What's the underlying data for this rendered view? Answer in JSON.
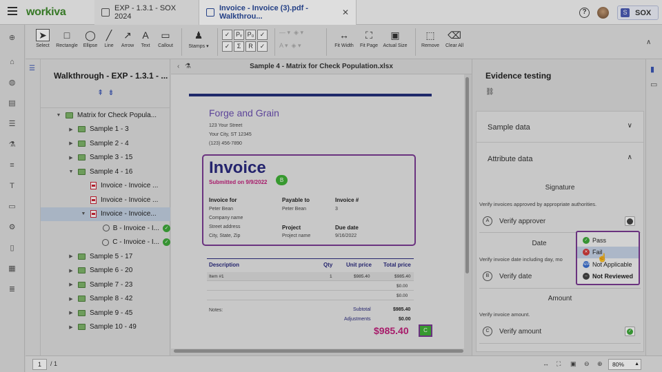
{
  "app": {
    "logo": "workiva"
  },
  "tabs": [
    {
      "label": "EXP - 1.3.1 - SOX 2024"
    },
    {
      "label": "Invoice - Invoice (3).pdf - Walkthrou..."
    }
  ],
  "user": {
    "initial": "S",
    "name": "SOX"
  },
  "toolbar": {
    "tools": [
      "Select",
      "Rectangle",
      "Ellipse",
      "Line",
      "Arrow",
      "Text",
      "Callout",
      "Stamps",
      "Fit Width",
      "Fit Page",
      "Actual Size",
      "Remove",
      "Clear All"
    ],
    "stamp_glyphs": [
      "✓",
      "Pᵥ",
      "P₀",
      "✓",
      "✓",
      "Σ",
      "R",
      "✓"
    ]
  },
  "left_panel": {
    "title": "Walkthrough - EXP - 1.3.1 - ...",
    "tree": [
      {
        "label": "Matrix for Check Popula...",
        "kind": "folder",
        "indent": 0,
        "caret": "▼"
      },
      {
        "label": "Sample 1 - 3",
        "kind": "folder",
        "indent": 1,
        "caret": "▶"
      },
      {
        "label": "Sample 2 - 4",
        "kind": "folder",
        "indent": 1,
        "caret": "▶"
      },
      {
        "label": "Sample 3 - 15",
        "kind": "folder",
        "indent": 1,
        "caret": "▶"
      },
      {
        "label": "Sample 4 - 16",
        "kind": "folder",
        "indent": 1,
        "caret": "▼"
      },
      {
        "label": "Invoice - Invoice ...",
        "kind": "pdf",
        "indent": 2,
        "caret": ""
      },
      {
        "label": "Invoice - Invoice ...",
        "kind": "pdf",
        "indent": 2,
        "caret": ""
      },
      {
        "label": "Invoice - Invoice...",
        "kind": "pdf",
        "indent": 2,
        "caret": "▼",
        "selected": true
      },
      {
        "label": "B - Invoice - I...",
        "kind": "evidence",
        "indent": 3,
        "caret": "",
        "check": true
      },
      {
        "label": "C - Invoice - I...",
        "kind": "evidence",
        "indent": 3,
        "caret": "",
        "check": true
      },
      {
        "label": "Sample 5 - 17",
        "kind": "folder",
        "indent": 1,
        "caret": "▶"
      },
      {
        "label": "Sample 6 - 20",
        "kind": "folder",
        "indent": 1,
        "caret": "▶"
      },
      {
        "label": "Sample 7 - 23",
        "kind": "folder",
        "indent": 1,
        "caret": "▶"
      },
      {
        "label": "Sample 8 - 42",
        "kind": "folder",
        "indent": 1,
        "caret": "▶"
      },
      {
        "label": "Sample 9 - 45",
        "kind": "folder",
        "indent": 1,
        "caret": "▶"
      },
      {
        "label": "Sample 10 - 49",
        "kind": "folder",
        "indent": 1,
        "caret": "▶"
      }
    ]
  },
  "center": {
    "file_name": "Sample 4 - Matrix for Check Population.xlsx",
    "invoice": {
      "company": "Forge and Grain",
      "address": [
        "123 Your Street",
        "Your City, ST 12345",
        "(123) 456-7890"
      ],
      "title": "Invoice",
      "submitted": "Submitted on 9/9/2022",
      "badge_b": "B",
      "invoice_for_label": "Invoice for",
      "invoice_for": [
        "Peter Bean",
        "Company name",
        "Street address",
        "City, State, Zip"
      ],
      "payable_label": "Payable to",
      "payable": "Peter Bean",
      "project_label": "Project",
      "project": "Project name",
      "invoice_no_label": "Invoice #",
      "invoice_no": "3",
      "due_label": "Due date",
      "due": "9/16/2022",
      "table_headers": [
        "Description",
        "Qty",
        "Unit price",
        "Total price"
      ],
      "rows": [
        {
          "desc": "Item #1",
          "qty": "1",
          "unit": "$985.40",
          "total": "$985.40"
        },
        {
          "desc": "",
          "qty": "",
          "unit": "",
          "total": "$0.00"
        },
        {
          "desc": "",
          "qty": "",
          "unit": "",
          "total": "$0.00"
        }
      ],
      "notes_label": "Notes:",
      "subtotal_label": "Subtotal",
      "subtotal": "$985.40",
      "adjustments_label": "Adjustments",
      "adjustments": "$0.00",
      "total": "$985.40",
      "badge_c": "C"
    }
  },
  "right_panel": {
    "title": "Evidence testing",
    "sections": [
      {
        "label": "Sample data",
        "chevron": "∨"
      },
      {
        "label": "Attribute data",
        "chevron": "∧"
      }
    ],
    "attributes": [
      {
        "heading": "Signature",
        "desc": "Verify invoices approved by appropriate authorities.",
        "letter": "A",
        "name": "Verify approver",
        "status": "not-reviewed"
      },
      {
        "heading": "Date",
        "desc": "Verify invoice date including day, mo",
        "letter": "B",
        "name": "Verify date",
        "status": "none"
      },
      {
        "heading": "Amount",
        "desc": "Verify invoice amount.",
        "letter": "C",
        "name": "Verify amount",
        "status": "pass"
      }
    ],
    "status_menu": [
      {
        "label": "Pass",
        "color": "#3fa93a",
        "glyph": "✓"
      },
      {
        "label": "Fail",
        "color": "#d33a3a",
        "glyph": "✕",
        "highlighted": true
      },
      {
        "label": "Not Applicable",
        "color": "#3a6fd0",
        "glyph": "N/A"
      },
      {
        "label": "Not Reviewed",
        "color": "#444444",
        "glyph": "–",
        "bold": true
      }
    ]
  },
  "bottom": {
    "page": "1",
    "of": "/ 1",
    "zoom": "80%"
  },
  "colors": {
    "brand": "#3f8a2c",
    "accent_purple": "#7a3a92",
    "invoice_blue": "#2a2a7e",
    "invoice_pink": "#c01f7a"
  }
}
